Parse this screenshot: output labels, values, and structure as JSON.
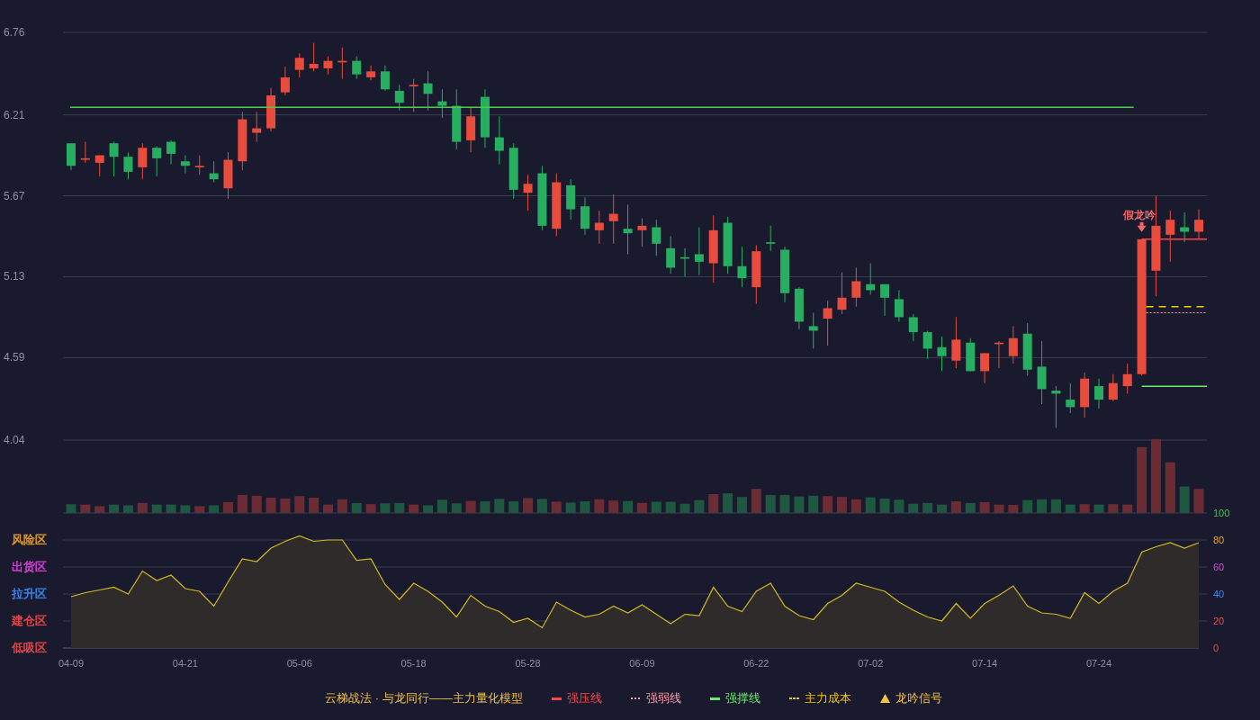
{
  "price_chart": {
    "chart_data": {
      "type": "candlestick",
      "ylim": [
        4.04,
        6.76
      ],
      "yticks": [
        4.04,
        4.59,
        5.13,
        5.67,
        6.21,
        6.76
      ],
      "grid": true,
      "categories": [
        null,
        null,
        null,
        null,
        null,
        null,
        null,
        null,
        null,
        null,
        null,
        null,
        null,
        null,
        null,
        null,
        null,
        null,
        null,
        null,
        null,
        null,
        null,
        null,
        null,
        null,
        null,
        null,
        null,
        null,
        null,
        null,
        null,
        null,
        null,
        null,
        null,
        null,
        null,
        null,
        null,
        null,
        null,
        null,
        null,
        null,
        null,
        null,
        null,
        null,
        null,
        null,
        null,
        null,
        null,
        null,
        null,
        null,
        null,
        null,
        null,
        null,
        null,
        null,
        null,
        null,
        null,
        null,
        null,
        null,
        null,
        null,
        null,
        null,
        null,
        null,
        null,
        null,
        null,
        null
      ],
      "ohlc": [
        [
          6.02,
          6.02,
          5.84,
          5.87
        ],
        [
          5.91,
          6.03,
          5.89,
          5.92
        ],
        [
          5.89,
          5.94,
          5.8,
          5.94
        ],
        [
          6.02,
          6.03,
          5.8,
          5.93
        ],
        [
          5.93,
          5.96,
          5.78,
          5.83
        ],
        [
          5.86,
          6.02,
          5.78,
          5.99
        ],
        [
          5.99,
          6.0,
          5.8,
          5.92
        ],
        [
          6.03,
          6.04,
          5.88,
          5.95
        ],
        [
          5.9,
          5.94,
          5.82,
          5.87
        ],
        [
          5.86,
          5.94,
          5.81,
          5.87
        ],
        [
          5.82,
          5.9,
          5.76,
          5.78
        ],
        [
          5.72,
          5.96,
          5.65,
          5.91
        ],
        [
          5.9,
          6.23,
          5.84,
          6.18
        ],
        [
          6.09,
          6.23,
          6.03,
          6.12
        ],
        [
          6.12,
          6.39,
          6.1,
          6.34
        ],
        [
          6.36,
          6.53,
          6.34,
          6.46
        ],
        [
          6.51,
          6.62,
          6.46,
          6.59
        ],
        [
          6.52,
          6.69,
          6.5,
          6.55
        ],
        [
          6.52,
          6.6,
          6.48,
          6.57
        ],
        [
          6.56,
          6.66,
          6.45,
          6.57
        ],
        [
          6.57,
          6.6,
          6.45,
          6.48
        ],
        [
          6.46,
          6.54,
          6.44,
          6.5
        ],
        [
          6.5,
          6.54,
          6.37,
          6.38
        ],
        [
          6.37,
          6.41,
          6.24,
          6.29
        ],
        [
          6.4,
          6.45,
          6.23,
          6.41
        ],
        [
          6.42,
          6.5,
          6.24,
          6.35
        ],
        [
          6.3,
          6.38,
          6.19,
          6.27
        ],
        [
          6.27,
          6.38,
          5.98,
          6.03
        ],
        [
          6.04,
          6.26,
          5.96,
          6.2
        ],
        [
          6.33,
          6.38,
          5.99,
          6.06
        ],
        [
          6.06,
          6.2,
          5.88,
          5.97
        ],
        [
          5.99,
          6.02,
          5.65,
          5.71
        ],
        [
          5.69,
          5.81,
          5.57,
          5.75
        ],
        [
          5.82,
          5.87,
          5.44,
          5.47
        ],
        [
          5.45,
          5.82,
          5.4,
          5.76
        ],
        [
          5.74,
          5.78,
          5.51,
          5.58
        ],
        [
          5.6,
          5.66,
          5.41,
          5.45
        ],
        [
          5.44,
          5.57,
          5.35,
          5.49
        ],
        [
          5.5,
          5.68,
          5.35,
          5.55
        ],
        [
          5.45,
          5.61,
          5.28,
          5.42
        ],
        [
          5.44,
          5.52,
          5.33,
          5.47
        ],
        [
          5.46,
          5.51,
          5.27,
          5.35
        ],
        [
          5.32,
          5.4,
          5.15,
          5.19
        ],
        [
          5.26,
          5.32,
          5.13,
          5.25
        ],
        [
          5.28,
          5.46,
          5.14,
          5.23
        ],
        [
          5.22,
          5.54,
          5.09,
          5.44
        ],
        [
          5.49,
          5.53,
          5.15,
          5.2
        ],
        [
          5.2,
          5.33,
          5.06,
          5.12
        ],
        [
          5.06,
          5.34,
          4.95,
          5.3
        ],
        [
          5.36,
          5.47,
          5.3,
          5.35
        ],
        [
          5.31,
          5.33,
          4.96,
          5.02
        ],
        [
          5.05,
          5.06,
          4.78,
          4.83
        ],
        [
          4.8,
          4.89,
          4.65,
          4.77
        ],
        [
          4.85,
          4.97,
          4.67,
          4.92
        ],
        [
          4.91,
          5.16,
          4.88,
          4.99
        ],
        [
          4.99,
          5.19,
          4.93,
          5.1
        ],
        [
          5.08,
          5.22,
          5.01,
          5.04
        ],
        [
          5.08,
          5.08,
          4.87,
          4.99
        ],
        [
          4.98,
          5.04,
          4.83,
          4.86
        ],
        [
          4.86,
          4.88,
          4.7,
          4.76
        ],
        [
          4.76,
          4.77,
          4.58,
          4.65
        ],
        [
          4.66,
          4.73,
          4.5,
          4.6
        ],
        [
          4.57,
          4.86,
          4.52,
          4.71
        ],
        [
          4.69,
          4.72,
          4.5,
          4.5
        ],
        [
          4.5,
          4.62,
          4.42,
          4.62
        ],
        [
          4.68,
          4.7,
          4.52,
          4.69
        ],
        [
          4.6,
          4.8,
          4.55,
          4.72
        ],
        [
          4.75,
          4.82,
          4.47,
          4.51
        ],
        [
          4.53,
          4.7,
          4.28,
          4.38
        ],
        [
          4.37,
          4.4,
          4.12,
          4.35
        ],
        [
          4.31,
          4.42,
          4.22,
          4.26
        ],
        [
          4.26,
          4.49,
          4.19,
          4.45
        ],
        [
          4.4,
          4.45,
          4.25,
          4.31
        ],
        [
          4.31,
          4.48,
          4.3,
          4.42
        ],
        [
          4.4,
          4.55,
          4.35,
          4.48
        ],
        [
          4.48,
          5.38,
          4.47,
          5.38
        ],
        [
          5.17,
          5.67,
          5.0,
          5.47
        ],
        [
          5.41,
          5.57,
          5.23,
          5.51
        ],
        [
          5.46,
          5.56,
          5.36,
          5.43
        ],
        [
          5.43,
          5.58,
          5.38,
          5.51
        ]
      ],
      "ref_lines": [
        {
          "axis": "y",
          "value": 6.26,
          "color": "#4fc94f"
        }
      ],
      "annotations": [
        "假龙吟"
      ]
    }
  },
  "indicator_chart": {
    "chart_data": {
      "type": "area",
      "ylim": [
        0,
        100
      ],
      "grid": true,
      "categories": [
        "04-09",
        null,
        null,
        null,
        null,
        null,
        null,
        null,
        "04-21",
        null,
        null,
        null,
        null,
        null,
        null,
        null,
        "05-06",
        null,
        null,
        null,
        null,
        null,
        null,
        null,
        "05-18",
        null,
        null,
        null,
        null,
        null,
        null,
        null,
        "05-28",
        null,
        null,
        null,
        null,
        null,
        null,
        null,
        "06-09",
        null,
        null,
        null,
        null,
        null,
        null,
        null,
        "06-22",
        null,
        null,
        null,
        null,
        null,
        null,
        null,
        "07-02",
        null,
        null,
        null,
        null,
        null,
        null,
        null,
        "07-14",
        null,
        null,
        null,
        null,
        null,
        null,
        null,
        "07-24",
        null,
        null,
        null,
        null,
        null,
        null,
        null
      ],
      "yticks": [
        100,
        80,
        60,
        40,
        20,
        0
      ],
      "series": [
        {
          "color": "#d4b81c",
          "values": [
            38,
            41,
            43,
            45,
            40,
            57,
            50,
            54,
            44,
            42,
            31,
            49,
            66,
            64,
            74,
            79,
            83,
            79,
            80,
            80,
            65,
            66,
            47,
            36,
            48,
            42,
            34,
            23,
            39,
            31,
            27,
            19,
            22,
            15,
            34,
            28,
            23,
            25,
            31,
            26,
            32,
            25,
            18,
            25,
            24,
            45,
            31,
            27,
            42,
            48,
            31,
            24,
            21,
            33,
            39,
            48,
            45,
            42,
            34,
            28,
            23,
            20,
            33,
            22,
            33,
            39,
            46,
            31,
            26,
            25,
            22,
            41,
            33,
            42,
            48,
            71,
            75,
            78,
            74,
            78
          ]
        }
      ]
    },
    "zones": [
      {
        "label": "风险区",
        "color": "#f0a020"
      },
      {
        "label": "出货区",
        "color": "#e040e0"
      },
      {
        "label": "拉升区",
        "color": "#3d8af7"
      },
      {
        "label": "建仓区",
        "color": "#f04848"
      },
      {
        "label": "低吸区",
        "color": "#f04848"
      }
    ]
  },
  "legend": {
    "title": "云梯战法 · 与龙同行——主力量化模型",
    "items": [
      {
        "kind": "solid",
        "label": "强压线",
        "color": "#ff4545"
      },
      {
        "kind": "dotted",
        "label": "强弱线",
        "color": "#ff9aa6"
      },
      {
        "kind": "solid",
        "label": "强撑线",
        "color": "#66ee66"
      },
      {
        "kind": "dashed",
        "label": "主力成本",
        "color": "#f5c800"
      },
      {
        "kind": "triangle",
        "label": "龙吟信号",
        "color": "#f5c242"
      }
    ]
  }
}
